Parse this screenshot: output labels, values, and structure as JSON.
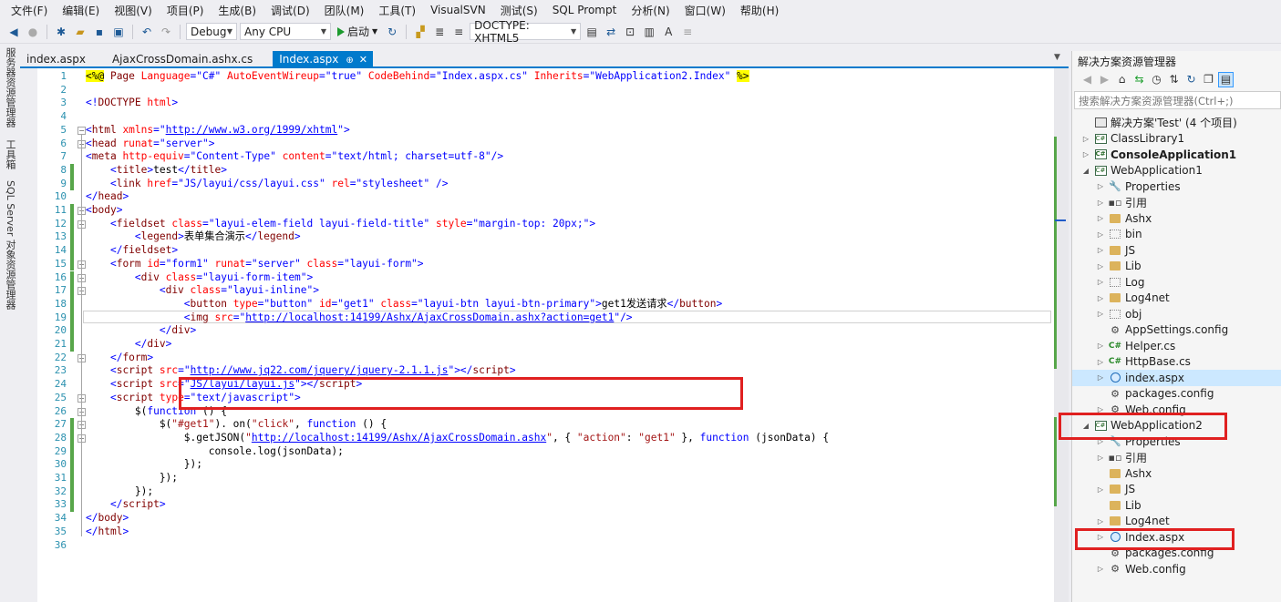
{
  "menu": [
    "文件(F)",
    "编辑(E)",
    "视图(V)",
    "项目(P)",
    "生成(B)",
    "调试(D)",
    "团队(M)",
    "工具(T)",
    "VisualSVN",
    "测试(S)",
    "SQL Prompt",
    "分析(N)",
    "窗口(W)",
    "帮助(H)"
  ],
  "toolbar": {
    "config": "Debug",
    "platform": "Any CPU",
    "start_label": "启动",
    "doctype": "DOCTYPE: XHTML5"
  },
  "side_tabs": [
    "服务器资源管理器",
    "工具箱",
    "SQL Server 对象资源管理器"
  ],
  "doc_tabs": [
    {
      "label": "index.aspx",
      "active": false
    },
    {
      "label": "AjaxCrossDomain.ashx.cs",
      "active": false
    },
    {
      "label": "Index.aspx",
      "active": true
    }
  ],
  "code": {
    "line_numbers": [
      "1",
      "2",
      "3",
      "4",
      "5",
      "6",
      "7",
      "8",
      "9",
      "10",
      "11",
      "12",
      "13",
      "14",
      "15",
      "16",
      "17",
      "18",
      "19",
      "20",
      "21",
      "22",
      "23",
      "24",
      "25",
      "26",
      "27",
      "28",
      "29",
      "30",
      "31",
      "32",
      "33",
      "34",
      "35",
      "36"
    ],
    "lines": [
      [
        [
          "dir",
          "<%@"
        ],
        [
          "tag",
          " Page "
        ],
        [
          "at",
          "Language"
        ],
        [
          "st",
          "=\"C#\" "
        ],
        [
          "at",
          "AutoEventWireup"
        ],
        [
          "st",
          "=\"true\" "
        ],
        [
          "at",
          "CodeBehind"
        ],
        [
          "st",
          "=\"Index.aspx.cs\" "
        ],
        [
          "at",
          "Inherits"
        ],
        [
          "st",
          "=\"WebApplication2.Index\" "
        ],
        [
          "dir",
          "%>"
        ]
      ],
      [],
      [
        [
          "kw",
          "<!"
        ],
        [
          "tag",
          "DOCTYPE "
        ],
        [
          "at",
          "html"
        ],
        [
          "kw",
          ">"
        ]
      ],
      [],
      [
        [
          "kw",
          "<"
        ],
        [
          "tag",
          "html "
        ],
        [
          "at",
          "xmlns"
        ],
        [
          "kw",
          "=\""
        ],
        [
          "url",
          "http://www.w3.org/1999/xhtml"
        ],
        [
          "kw",
          "\">"
        ]
      ],
      [
        [
          "kw",
          "<"
        ],
        [
          "tag",
          "head "
        ],
        [
          "at",
          "runat"
        ],
        [
          "kw",
          "=\"server\">"
        ]
      ],
      [
        [
          "kw",
          "<"
        ],
        [
          "tag",
          "meta "
        ],
        [
          "at",
          "http-equiv"
        ],
        [
          "kw",
          "=\"Content-Type\" "
        ],
        [
          "at",
          "content"
        ],
        [
          "kw",
          "=\"text/html; charset=utf-8\"/>"
        ]
      ],
      [
        [
          "txt",
          "    "
        ],
        [
          "kw",
          "<"
        ],
        [
          "tag",
          "title"
        ],
        [
          "kw",
          ">"
        ],
        [
          "txt",
          "test"
        ],
        [
          "kw",
          "</"
        ],
        [
          "tag",
          "title"
        ],
        [
          "kw",
          ">"
        ]
      ],
      [
        [
          "txt",
          "    "
        ],
        [
          "kw",
          "<"
        ],
        [
          "tag",
          "link "
        ],
        [
          "at",
          "href"
        ],
        [
          "kw",
          "=\"JS/layui/css/layui.css\" "
        ],
        [
          "at",
          "rel"
        ],
        [
          "kw",
          "=\"stylesheet\" />"
        ]
      ],
      [
        [
          "kw",
          "</"
        ],
        [
          "tag",
          "head"
        ],
        [
          "kw",
          ">"
        ]
      ],
      [
        [
          "kw",
          "<"
        ],
        [
          "tag",
          "body"
        ],
        [
          "kw",
          ">"
        ]
      ],
      [
        [
          "txt",
          "    "
        ],
        [
          "kw",
          "<"
        ],
        [
          "tag",
          "fieldset "
        ],
        [
          "at",
          "class"
        ],
        [
          "kw",
          "=\"layui-elem-field layui-field-title\" "
        ],
        [
          "at",
          "style"
        ],
        [
          "kw",
          "=\"margin-top: 20px;\">"
        ]
      ],
      [
        [
          "txt",
          "        "
        ],
        [
          "kw",
          "<"
        ],
        [
          "tag",
          "legend"
        ],
        [
          "kw",
          ">"
        ],
        [
          "txt",
          "表单集合演示"
        ],
        [
          "kw",
          "</"
        ],
        [
          "tag",
          "legend"
        ],
        [
          "kw",
          ">"
        ]
      ],
      [
        [
          "txt",
          "    "
        ],
        [
          "kw",
          "</"
        ],
        [
          "tag",
          "fieldset"
        ],
        [
          "kw",
          ">"
        ]
      ],
      [
        [
          "txt",
          "    "
        ],
        [
          "kw",
          "<"
        ],
        [
          "tag",
          "form "
        ],
        [
          "at",
          "id"
        ],
        [
          "kw",
          "=\"form1\" "
        ],
        [
          "at",
          "runat"
        ],
        [
          "kw",
          "=\"server\" "
        ],
        [
          "at",
          "class"
        ],
        [
          "kw",
          "=\"layui-form\">"
        ]
      ],
      [
        [
          "txt",
          "        "
        ],
        [
          "kw",
          "<"
        ],
        [
          "tag",
          "div "
        ],
        [
          "at",
          "class"
        ],
        [
          "kw",
          "=\"layui-form-item\">"
        ]
      ],
      [
        [
          "txt",
          "            "
        ],
        [
          "kw",
          "<"
        ],
        [
          "tag",
          "div "
        ],
        [
          "at",
          "class"
        ],
        [
          "kw",
          "=\"layui-inline\">"
        ]
      ],
      [
        [
          "txt",
          "                "
        ],
        [
          "kw",
          "<"
        ],
        [
          "tag",
          "button "
        ],
        [
          "at",
          "type"
        ],
        [
          "kw",
          "=\"button\" "
        ],
        [
          "at",
          "id"
        ],
        [
          "kw",
          "=\"get1\" "
        ],
        [
          "at",
          "class"
        ],
        [
          "kw",
          "=\"layui-btn layui-btn-primary\">"
        ],
        [
          "txt",
          "get1发送请求"
        ],
        [
          "kw",
          "</"
        ],
        [
          "tag",
          "button"
        ],
        [
          "kw",
          ">"
        ]
      ],
      [
        [
          "txt",
          "                "
        ],
        [
          "kw",
          "<"
        ],
        [
          "tag",
          "img "
        ],
        [
          "at",
          "src"
        ],
        [
          "kw",
          "=\""
        ],
        [
          "url",
          "http://localhost:14199/Ashx/AjaxCrossDomain.ashx?action=get1"
        ],
        [
          "kw",
          "\"/>"
        ]
      ],
      [
        [
          "txt",
          "            "
        ],
        [
          "kw",
          "</"
        ],
        [
          "tag",
          "div"
        ],
        [
          "kw",
          ">"
        ]
      ],
      [
        [
          "txt",
          "        "
        ],
        [
          "kw",
          "</"
        ],
        [
          "tag",
          "div"
        ],
        [
          "kw",
          ">"
        ]
      ],
      [
        [
          "txt",
          "    "
        ],
        [
          "kw",
          "</"
        ],
        [
          "tag",
          "form"
        ],
        [
          "kw",
          ">"
        ]
      ],
      [
        [
          "txt",
          "    "
        ],
        [
          "kw",
          "<"
        ],
        [
          "tag",
          "script "
        ],
        [
          "at",
          "src"
        ],
        [
          "kw",
          "=\""
        ],
        [
          "url",
          "http://www.jq22.com/jquery/jquery-2.1.1.js"
        ],
        [
          "kw",
          "\"></"
        ],
        [
          "tag",
          "script"
        ],
        [
          "kw",
          ">"
        ]
      ],
      [
        [
          "txt",
          "    "
        ],
        [
          "kw",
          "<"
        ],
        [
          "tag",
          "script "
        ],
        [
          "at",
          "src"
        ],
        [
          "kw",
          "=\""
        ],
        [
          "url",
          "JS/layui/layui.js"
        ],
        [
          "kw",
          "\"></"
        ],
        [
          "tag",
          "script"
        ],
        [
          "kw",
          ">"
        ]
      ],
      [
        [
          "txt",
          "    "
        ],
        [
          "kw",
          "<"
        ],
        [
          "tag",
          "script "
        ],
        [
          "at",
          "type"
        ],
        [
          "kw",
          "=\"text/javascript\">"
        ]
      ],
      [
        [
          "txt",
          "        $("
        ],
        [
          "kw",
          "function"
        ],
        [
          "txt",
          " () {"
        ]
      ],
      [
        [
          "txt",
          "            $("
        ],
        [
          "str",
          "\"#get1\""
        ],
        [
          "txt",
          "). on("
        ],
        [
          "str",
          "\"click\""
        ],
        [
          "txt",
          ", "
        ],
        [
          "kw",
          "function"
        ],
        [
          "txt",
          " () {"
        ]
      ],
      [
        [
          "txt",
          "                $.getJSON("
        ],
        [
          "str",
          "\""
        ],
        [
          "url",
          "http://localhost:14199/Ashx/AjaxCrossDomain.ashx"
        ],
        [
          "str",
          "\""
        ],
        [
          "txt",
          ", { "
        ],
        [
          "str",
          "\"action\""
        ],
        [
          "txt",
          ": "
        ],
        [
          "str",
          "\"get1\""
        ],
        [
          "txt",
          " }, "
        ],
        [
          "kw",
          "function"
        ],
        [
          "txt",
          " (jsonData) {"
        ]
      ],
      [
        [
          "txt",
          "                    console.log(jsonData);"
        ]
      ],
      [
        [
          "txt",
          "                });"
        ]
      ],
      [
        [
          "txt",
          "            });"
        ]
      ],
      [
        [
          "txt",
          "        });"
        ]
      ],
      [
        [
          "txt",
          "    "
        ],
        [
          "kw",
          "</"
        ],
        [
          "tag",
          "script"
        ],
        [
          "kw",
          ">"
        ]
      ],
      [
        [
          "kw",
          "</"
        ],
        [
          "tag",
          "body"
        ],
        [
          "kw",
          ">"
        ]
      ],
      [
        [
          "kw",
          "</"
        ],
        [
          "tag",
          "html"
        ],
        [
          "kw",
          ">"
        ]
      ],
      []
    ]
  },
  "solution_explorer": {
    "title": "解决方案资源管理器",
    "search_placeholder": "搜索解决方案资源管理器(Ctrl+;)",
    "items": [
      {
        "label": "解决方案'Test' (4 个项目)",
        "level": 0,
        "icon": "sol",
        "exp": ""
      },
      {
        "label": "ClassLibrary1",
        "level": 0,
        "icon": "proj",
        "exp": "right"
      },
      {
        "label": "ConsoleApplication1",
        "level": 0,
        "icon": "proj",
        "exp": "right",
        "bold": true
      },
      {
        "label": "WebApplication1",
        "level": 0,
        "icon": "proj",
        "exp": "down"
      },
      {
        "label": "Properties",
        "level": 1,
        "icon": "wrench",
        "exp": "right"
      },
      {
        "label": "引用",
        "level": 1,
        "icon": "ref",
        "exp": "right"
      },
      {
        "label": "Ashx",
        "level": 1,
        "icon": "folder",
        "exp": "right"
      },
      {
        "label": "bin",
        "level": 1,
        "icon": "folder-dot",
        "exp": "right"
      },
      {
        "label": "JS",
        "level": 1,
        "icon": "folder",
        "exp": "right"
      },
      {
        "label": "Lib",
        "level": 1,
        "icon": "folder",
        "exp": "right"
      },
      {
        "label": "Log",
        "level": 1,
        "icon": "folder-dot",
        "exp": "right"
      },
      {
        "label": "Log4net",
        "level": 1,
        "icon": "folder",
        "exp": "right"
      },
      {
        "label": "obj",
        "level": 1,
        "icon": "folder-dot",
        "exp": "right"
      },
      {
        "label": "AppSettings.config",
        "level": 1,
        "icon": "cfg",
        "exp": ""
      },
      {
        "label": "Helper.cs",
        "level": 1,
        "icon": "cs",
        "exp": "right"
      },
      {
        "label": "HttpBase.cs",
        "level": 1,
        "icon": "cs",
        "exp": "right"
      },
      {
        "label": "index.aspx",
        "level": 1,
        "icon": "glob",
        "exp": "right",
        "sel": true
      },
      {
        "label": "packages.config",
        "level": 1,
        "icon": "cfg",
        "exp": ""
      },
      {
        "label": "Web.config",
        "level": 1,
        "icon": "cfg",
        "exp": "right"
      },
      {
        "label": "WebApplication2",
        "level": 0,
        "icon": "proj",
        "exp": "down"
      },
      {
        "label": "Properties",
        "level": 1,
        "icon": "wrench",
        "exp": "right"
      },
      {
        "label": "引用",
        "level": 1,
        "icon": "ref",
        "exp": "right"
      },
      {
        "label": "Ashx",
        "level": 1,
        "icon": "folder",
        "exp": ""
      },
      {
        "label": "JS",
        "level": 1,
        "icon": "folder",
        "exp": "right"
      },
      {
        "label": "Lib",
        "level": 1,
        "icon": "folder",
        "exp": ""
      },
      {
        "label": "Log4net",
        "level": 1,
        "icon": "folder",
        "exp": "right"
      },
      {
        "label": "Index.aspx",
        "level": 1,
        "icon": "glob",
        "exp": "right"
      },
      {
        "label": "packages.config",
        "level": 1,
        "icon": "cfg",
        "exp": ""
      },
      {
        "label": "Web.config",
        "level": 1,
        "icon": "cfg",
        "exp": "right"
      }
    ]
  }
}
